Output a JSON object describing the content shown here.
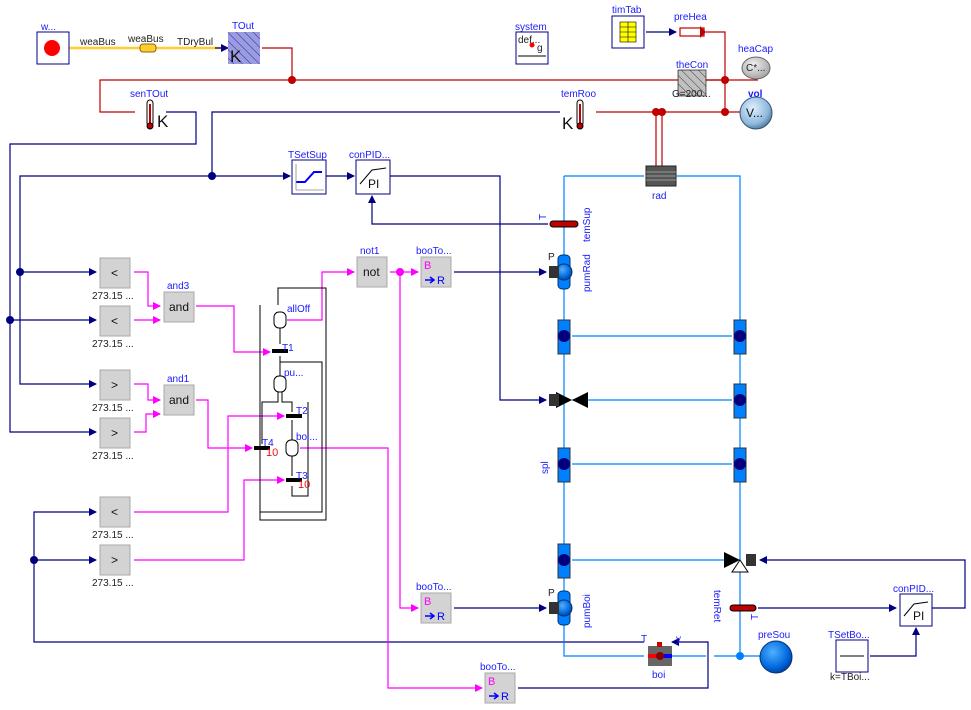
{
  "colors": {
    "signal": "#00007f",
    "boolean": "#ff00ff",
    "heat": "#bf0000",
    "fluid": "#0080ff",
    "bus": "#ffcc33",
    "label": "#1a1aff",
    "parameter_red": "#ee1111"
  },
  "weather": {
    "name": "w...",
    "bus_label_left": "weaBus",
    "bus_connector": "weaBus",
    "bus_signal": "TDryBul"
  },
  "tout": {
    "name": "TOut",
    "unit": "K"
  },
  "system": {
    "name": "system",
    "text": "def...",
    "g": "g"
  },
  "timTab": {
    "name": "timTab"
  },
  "preHea": {
    "name": "preHea"
  },
  "heaCap": {
    "name": "heaCap",
    "text": "C*..."
  },
  "theCon": {
    "name": "theCon",
    "param": "G=200..."
  },
  "vol": {
    "name": "vol",
    "text": "V..."
  },
  "senTOut": {
    "name": "senTOut",
    "unit": "K"
  },
  "temRoo": {
    "name": "temRoo",
    "unit": "K"
  },
  "TSetSup": {
    "name": "TSetSup"
  },
  "conPIDRad": {
    "name": "conPID...",
    "text": "PI"
  },
  "rad": {
    "name": "rad"
  },
  "temSup": {
    "name": "temSup",
    "port": "T"
  },
  "pumRad": {
    "name": "pumRad",
    "port": "P"
  },
  "spl": {
    "name": "spl"
  },
  "pumBoi": {
    "name": "pumBoi",
    "port": "P"
  },
  "temRet": {
    "name": "temRet",
    "port": "T"
  },
  "boi": {
    "name": "boi",
    "port_T": "T",
    "port_y": "y"
  },
  "preSou": {
    "name": "preSou"
  },
  "conPIDBoi": {
    "name": "conPID...",
    "text": "PI"
  },
  "TSetBoi": {
    "name": "TSetBo...",
    "param": "k=TBoi..."
  },
  "comparators": [
    {
      "symbol": "<",
      "param": "273.15 ..."
    },
    {
      "symbol": "<",
      "param": "273.15 ..."
    },
    {
      "symbol": ">",
      "param": "273.15 ..."
    },
    {
      "symbol": ">",
      "param": "273.15 ..."
    },
    {
      "symbol": "<",
      "param": "273.15 ..."
    },
    {
      "symbol": ">",
      "param": "273.15 ..."
    }
  ],
  "and3": {
    "name": "and3",
    "text": "and"
  },
  "and1": {
    "name": "and1",
    "text": "and"
  },
  "not1": {
    "name": "not1",
    "text": "not"
  },
  "booToRea": [
    {
      "name": "booTo...",
      "b": "B",
      "r": "R"
    },
    {
      "name": "booTo...",
      "b": "B",
      "r": "R"
    },
    {
      "name": "booTo...",
      "b": "B",
      "r": "R"
    }
  ],
  "stateMachine": {
    "steps": [
      {
        "name": "allOff"
      },
      {
        "name": "pu..."
      },
      {
        "name": "boi..."
      }
    ],
    "transitions": [
      {
        "name": "T1",
        "wait": ""
      },
      {
        "name": "T2",
        "wait": ""
      },
      {
        "name": "T3",
        "wait": "10"
      },
      {
        "name": "T4",
        "wait": "10"
      }
    ]
  }
}
